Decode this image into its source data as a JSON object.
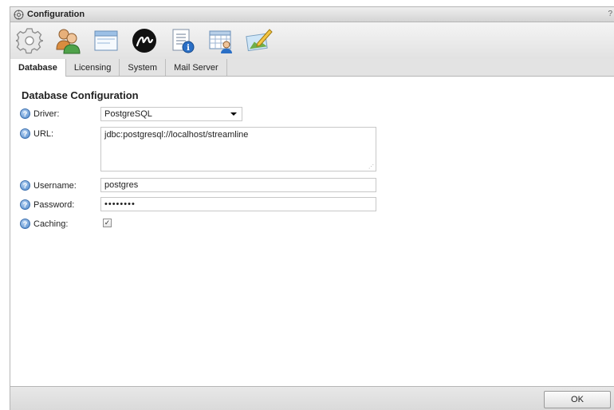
{
  "window": {
    "title": "Configuration",
    "help_glyph": "?"
  },
  "toolbar": {
    "buttons": [
      {
        "icon": "gear-icon"
      },
      {
        "icon": "users-icon"
      },
      {
        "icon": "window-icon"
      },
      {
        "icon": "brand-m-icon"
      },
      {
        "icon": "notepad-info-icon"
      },
      {
        "icon": "calendar-user-icon"
      },
      {
        "icon": "image-pencil-icon"
      }
    ]
  },
  "tabs": [
    {
      "label": "Database",
      "active": true
    },
    {
      "label": "Licensing",
      "active": false
    },
    {
      "label": "System",
      "active": false
    },
    {
      "label": "Mail Server",
      "active": false
    }
  ],
  "form": {
    "title": "Database Configuration",
    "driver": {
      "label": "Driver:",
      "value": "PostgreSQL"
    },
    "url": {
      "label": "URL:",
      "value": "jdbc:postgresql://localhost/streamline"
    },
    "username": {
      "label": "Username:",
      "value": "postgres"
    },
    "password": {
      "label": "Password:",
      "value": "••••••••"
    },
    "caching": {
      "label": "Caching:",
      "checked": true,
      "check_glyph": "✓"
    }
  },
  "footer": {
    "ok_label": "OK"
  },
  "colors": {
    "help_blue": "#4a85c9",
    "toolbar_bg": "#e8e8e8"
  }
}
